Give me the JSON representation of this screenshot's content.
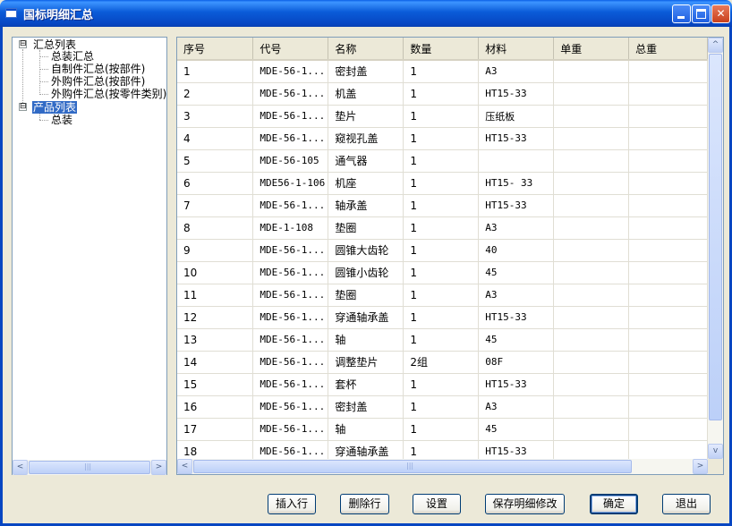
{
  "window": {
    "title": "国标明细汇总",
    "controls": {
      "minimize": "",
      "maximize": "",
      "close": "✕"
    }
  },
  "tree": {
    "root_summary": "汇总列表",
    "summary_children": [
      "总装汇总",
      "自制件汇总(按部件)",
      "外购件汇总(按部件)",
      "外购件汇总(按零件类别)"
    ],
    "root_product": "产品列表",
    "product_children": [
      "总装"
    ],
    "expander_symbol": "⊟"
  },
  "table": {
    "columns": [
      "序号",
      "代号",
      "名称",
      "数量",
      "材料",
      "单重",
      "总重"
    ],
    "rows": [
      [
        "1",
        "MDE-56-1...",
        "密封盖",
        "1",
        "A3",
        "",
        ""
      ],
      [
        "2",
        "MDE-56-1...",
        "机盖",
        "1",
        "HT15-33",
        "",
        ""
      ],
      [
        "3",
        "MDE-56-1...",
        "垫片",
        "1",
        "压纸板",
        "",
        ""
      ],
      [
        "4",
        "MDE-56-1...",
        "窥视孔盖",
        "1",
        "HT15-33",
        "",
        ""
      ],
      [
        "5",
        "MDE-56-105",
        "通气器",
        "1",
        "",
        "",
        ""
      ],
      [
        "6",
        "MDE56-1-106",
        "机座",
        "1",
        "HT15- 33",
        "",
        ""
      ],
      [
        "7",
        "MDE-56-1...",
        "轴承盖",
        "1",
        "HT15-33",
        "",
        ""
      ],
      [
        "8",
        "MDE-1-108",
        "垫圈",
        "1",
        "A3",
        "",
        ""
      ],
      [
        "9",
        "MDE-56-1...",
        "圆锥大齿轮",
        "1",
        "40",
        "",
        ""
      ],
      [
        "10",
        "MDE-56-1...",
        "圆锥小齿轮",
        "1",
        "45",
        "",
        ""
      ],
      [
        "11",
        "MDE-56-1...",
        "垫圈",
        "1",
        "A3",
        "",
        ""
      ],
      [
        "12",
        "MDE-56-1...",
        "穿通轴承盖",
        "1",
        "HT15-33",
        "",
        ""
      ],
      [
        "13",
        "MDE-56-1...",
        "轴",
        "1",
        "45",
        "",
        ""
      ],
      [
        "14",
        "MDE-56-1...",
        "调整垫片",
        "2组",
        "08F",
        "",
        ""
      ],
      [
        "15",
        "MDE-56-1...",
        "套杯",
        "1",
        "HT15-33",
        "",
        ""
      ],
      [
        "16",
        "MDE-56-1...",
        "密封盖",
        "1",
        "A3",
        "",
        ""
      ],
      [
        "17",
        "MDE-56-1...",
        "轴",
        "1",
        "45",
        "",
        ""
      ],
      [
        "18",
        "MDE-56-1...",
        "穿通轴承盖",
        "1",
        "HT15-33",
        "",
        ""
      ]
    ]
  },
  "scroll": {
    "left": "<",
    "right": ">",
    "up": "^",
    "down": "v",
    "grip": "|||"
  },
  "buttons": {
    "insert_row": "插入行",
    "delete_row": "删除行",
    "settings": "设置",
    "save_changes": "保存明细修改",
    "ok": "确定",
    "exit": "退出"
  }
}
